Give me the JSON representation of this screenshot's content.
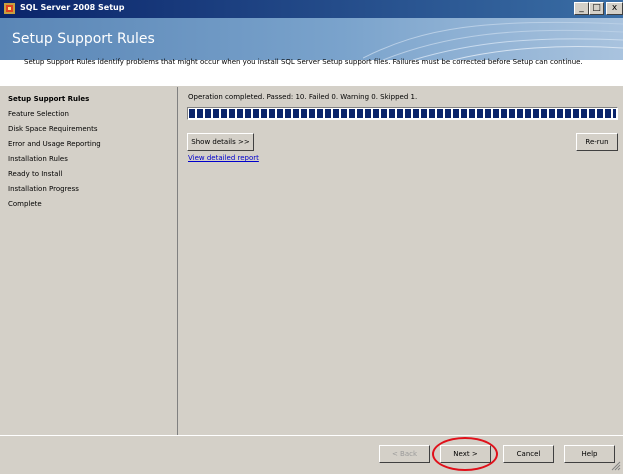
{
  "window": {
    "title": "SQL Server 2008 Setup",
    "minimize_label": "_",
    "maximize_label": "□",
    "close_label": "x"
  },
  "header": {
    "title": "Setup Support Rules",
    "description": "Setup Support Rules identify problems that might occur when you install SQL Server Setup support files. Failures must be corrected before Setup can continue."
  },
  "sidebar": {
    "items": [
      {
        "label": "Setup Support Rules",
        "active": true
      },
      {
        "label": "Feature Selection"
      },
      {
        "label": "Disk Space Requirements"
      },
      {
        "label": "Error and Usage Reporting"
      },
      {
        "label": "Installation Rules"
      },
      {
        "label": "Ready to Install"
      },
      {
        "label": "Installation Progress"
      },
      {
        "label": "Complete"
      }
    ]
  },
  "main": {
    "status": "Operation completed. Passed: 10.   Failed 0.   Warning 0.   Skipped 1.",
    "progress": 1.0,
    "show_details_label": "Show details >>",
    "rerun_label": "Re-run",
    "report_link": "View detailed report"
  },
  "footer": {
    "back_label": "< Back",
    "next_label": "Next >",
    "cancel_label": "Cancel",
    "help_label": "Help"
  },
  "colors": {
    "title_bar": "#0a246a",
    "header_band": "#5a86b6",
    "progress_fill": "#0a246a",
    "annotation_ring": "#e0101a",
    "link": "#0000cc"
  }
}
